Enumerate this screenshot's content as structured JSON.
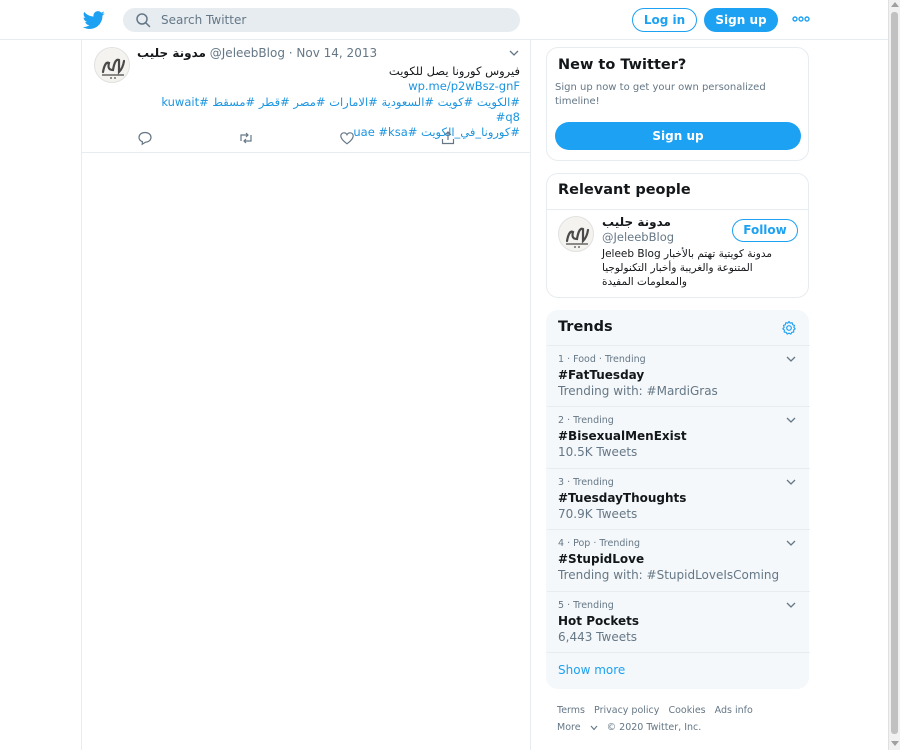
{
  "header": {
    "search_placeholder": "Search Twitter",
    "login_label": "Log in",
    "signup_label": "Sign up"
  },
  "tweet": {
    "author_name": "مدونة جليب",
    "author_handle": "@JeleebBlog",
    "separator": "·",
    "date": "Nov 14, 2013",
    "text_line1": "فيروس كورونا يصل للكويت",
    "link": "wp.me/p2wBsz-gnF",
    "hashtags_line1": "#الكويت #كويت #السعودية #الامارات #مصر #قطر #مسقط #kuwait #q8",
    "hashtags_line2": "#كورونا_في_الكويت #uae #ksa"
  },
  "new_to_twitter": {
    "title": "New to Twitter?",
    "description": "Sign up now to get your own personalized timeline!",
    "signup_label": "Sign up"
  },
  "relevant_people": {
    "title": "Relevant people",
    "person": {
      "name": "مدونة جليب",
      "handle": "@JeleebBlog",
      "follow_label": "Follow",
      "bio": "مدونة كويتية تهتم بالأخبار Jeleeb Blog المتنوعة والغريبة وأخبار التكنولوجيا والمعلومات المفيدة"
    }
  },
  "trends": {
    "title": "Trends",
    "items": [
      {
        "meta": "1 · Food · Trending",
        "title": "#FatTuesday",
        "sub": "Trending with: #MardiGras"
      },
      {
        "meta": "2 · Trending",
        "title": "#BisexualMenExist",
        "sub": "10.5K Tweets"
      },
      {
        "meta": "3 · Trending",
        "title": "#TuesdayThoughts",
        "sub": "70.9K Tweets"
      },
      {
        "meta": "4 · Pop · Trending",
        "title": "#StupidLove",
        "sub": "Trending with: #StupidLoveIsComing"
      },
      {
        "meta": "5 · Trending",
        "title": "Hot Pockets",
        "sub": "6,443 Tweets"
      }
    ],
    "show_more": "Show more"
  },
  "footer": {
    "terms": "Terms",
    "privacy": "Privacy policy",
    "cookies": "Cookies",
    "ads_info": "Ads info",
    "more": "More",
    "copyright": "© 2020 Twitter, Inc."
  },
  "colors": {
    "accent": "#1da1f2",
    "link": "#1b95e0",
    "muted": "#657786",
    "border": "#e6ecf0",
    "panel_bg": "#f5f8fa"
  }
}
